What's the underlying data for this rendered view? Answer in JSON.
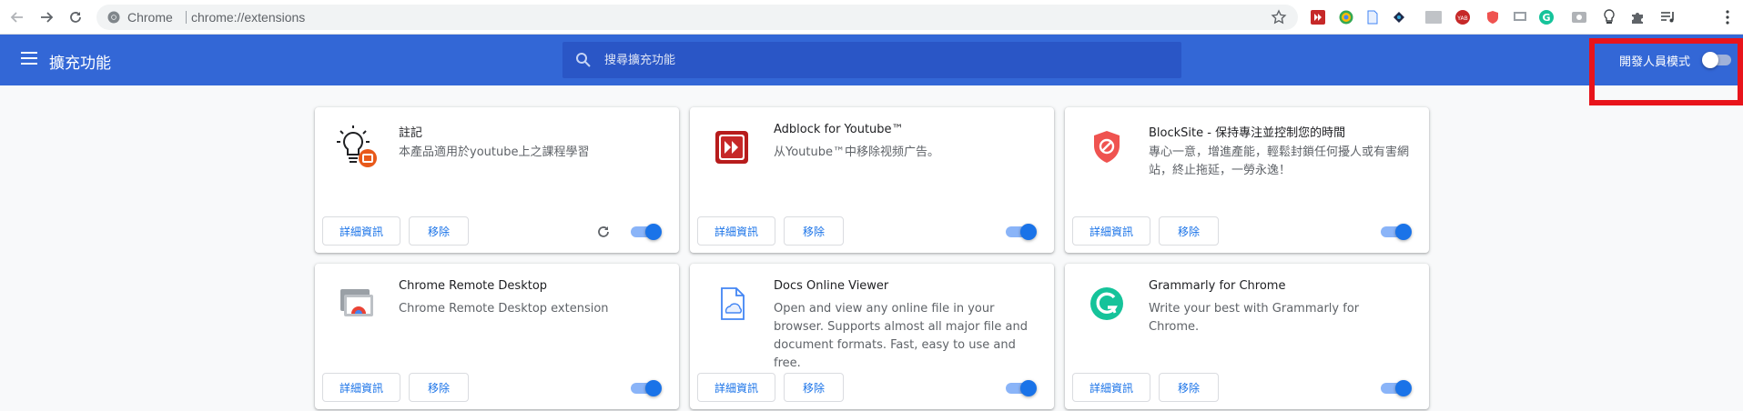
{
  "browser": {
    "omnibox_site": "Chrome",
    "omnibox_url": "chrome://extensions",
    "toolbar_extension_icons": [
      "adblock-youtube-icon",
      "speed-dial-icon",
      "docs-viewer-icon",
      "ink-bottle-icon",
      "gray-extension-icon",
      "yab-icon",
      "blocksite-icon",
      "remote-desktop-icon",
      "grammarly-icon",
      "video-icon",
      "lightbulb-icon",
      "puzzle-icon",
      "media-control-icon"
    ]
  },
  "header": {
    "title": "擴充功能",
    "search_placeholder": "搜尋擴充功能",
    "dev_mode_label": "開發人員模式",
    "dev_mode_enabled": false
  },
  "buttons": {
    "details": "詳細資訊",
    "remove": "移除"
  },
  "extensions": [
    {
      "name": "註記",
      "description": "本產品適用於youtube上之課程學習",
      "enabled": true,
      "has_reload": true,
      "icon": "lightbulb-icon"
    },
    {
      "name": "Adblock for Youtube™",
      "description": "从Youtube™中移除视频广告。",
      "enabled": true,
      "has_reload": false,
      "icon": "adblock-youtube-icon"
    },
    {
      "name": "BlockSite - 保持專注並控制您的時間",
      "description": "專心一意，增進產能，輕鬆封鎖任何擾人或有害網站，終止拖延，一勞永逸！",
      "enabled": true,
      "has_reload": false,
      "icon": "blocksite-shield-icon"
    },
    {
      "name": "Chrome Remote Desktop",
      "description": "Chrome Remote Desktop extension",
      "enabled": true,
      "has_reload": false,
      "icon": "remote-desktop-icon"
    },
    {
      "name": "Docs Online Viewer",
      "description": "Open and view any online file in your browser. Supports almost all major file and document formats. Fast, easy to use and free.",
      "enabled": true,
      "has_reload": false,
      "icon": "docs-viewer-icon"
    },
    {
      "name": "Grammarly for Chrome",
      "description": "Write your best with Grammarly for Chrome.",
      "enabled": true,
      "has_reload": false,
      "icon": "grammarly-icon"
    }
  ],
  "colors": {
    "header_blue": "#3367d6",
    "search_blue": "#2a56c6",
    "link_blue": "#1a73e8",
    "highlight_red": "#e8141b"
  }
}
